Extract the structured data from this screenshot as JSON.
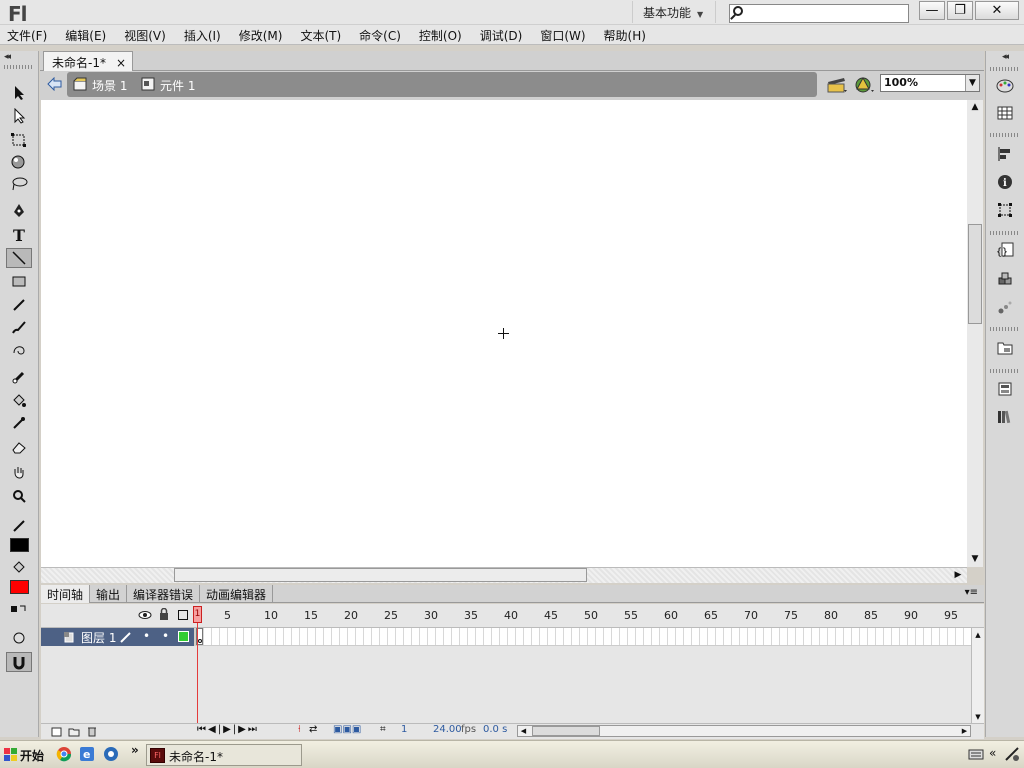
{
  "app": {
    "logo": "Fl",
    "workspace": "基本功能",
    "window_buttons": [
      "—",
      "❐",
      "✕"
    ]
  },
  "menu": [
    "文件(F)",
    "编辑(E)",
    "视图(V)",
    "插入(I)",
    "修改(M)",
    "文本(T)",
    "命令(C)",
    "控制(O)",
    "调试(D)",
    "窗口(W)",
    "帮助(H)"
  ],
  "document": {
    "tab_label": "未命名-1*",
    "close": "×"
  },
  "editbar": {
    "scene": "场景 1",
    "symbol": "元件 1",
    "zoom": "100%"
  },
  "timeline": {
    "tabs": [
      "时间轴",
      "输出",
      "编译器错误",
      "动画编辑器"
    ],
    "frame_numbers": [
      "1",
      "5",
      "10",
      "15",
      "20",
      "25",
      "30",
      "35",
      "40",
      "45",
      "50",
      "55",
      "60",
      "65",
      "70",
      "75",
      "80",
      "85",
      "90",
      "95"
    ],
    "layer": {
      "name": "图层 1"
    },
    "status": {
      "current_frame": "1",
      "fps": "24.00",
      "fps_unit": "fps",
      "time": "0.0 s"
    }
  },
  "colors": {
    "stroke": "#000000",
    "fill": "#ff0000",
    "layer_highlight": "#4d6185",
    "layer_color": "#33cc33"
  },
  "taskbar": {
    "start": "开始",
    "task": "未命名-1*",
    "chevron": "»"
  }
}
